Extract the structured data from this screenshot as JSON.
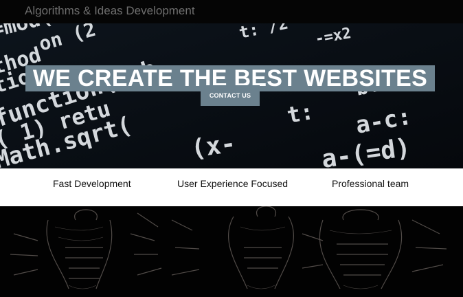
{
  "header": {
    "brand": "Algorithms & Ideas Development"
  },
  "hero": {
    "title": "WE CREATE THE BEST WEBSITES",
    "cta_label": "CONTACT US",
    "background": "code-snippet-image"
  },
  "features": {
    "items": [
      {
        "label": "Fast Development"
      },
      {
        "label": "User Experience Focused"
      },
      {
        "label": "Professional team"
      }
    ]
  },
  "bottom": {
    "background": "lightbulb-sketch-image"
  },
  "colors": {
    "accent": "#6b818e",
    "page_bg": "#000000",
    "features_bg": "#ffffff",
    "brand_text": "#6e6e6e"
  }
}
